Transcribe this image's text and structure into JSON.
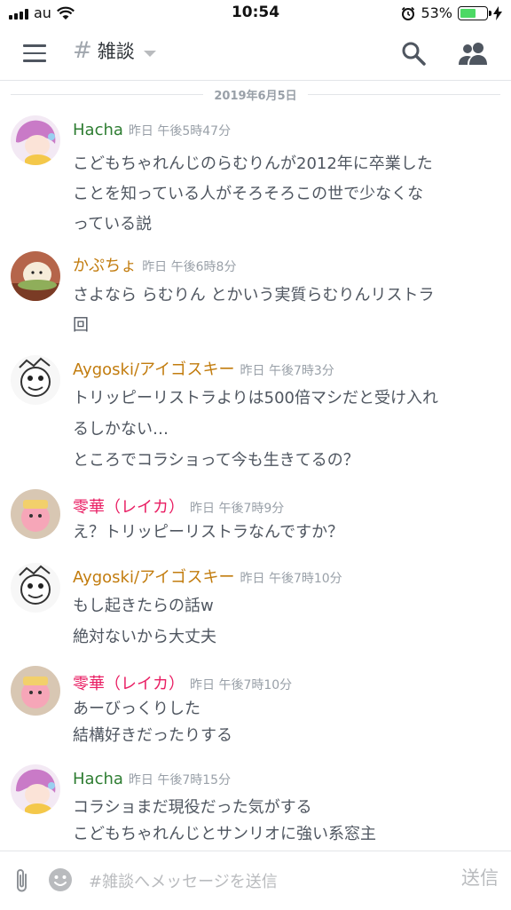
{
  "status": {
    "carrier": "au",
    "time": "10:54",
    "battery_pct": "53%",
    "battery_level": 0.53,
    "icons": [
      "signal-icon",
      "wifi-icon",
      "alarm-icon",
      "battery-icon",
      "charging-icon"
    ]
  },
  "header": {
    "hash": "#",
    "channel": "雑談",
    "icons": [
      "menu-icon",
      "search-icon",
      "members-icon",
      "chevron-down-icon"
    ]
  },
  "date_divider": "2019年6月5日",
  "messages": [
    {
      "user": "Hacha",
      "color": "#2e7d32",
      "time": "昨日 午後5時47分",
      "lines": [
        "こどもちゃれんじのらむりんが2012年に卒業した",
        "ことを知っている人がそろそろこの世で少なくな",
        "っている説"
      ]
    },
    {
      "user": "かぷちょ",
      "color": "#c27c0e",
      "time": "昨日 午後6時8分",
      "lines": [
        "さよなら らむりん とかいう実質らむりんリストラ",
        "回"
      ]
    },
    {
      "user": "Aygoski/アイゴスキー",
      "color": "#c27c0e",
      "time": "昨日 午後7時3分",
      "lines": [
        "トリッピーリストラよりは500倍マシだと受け入れ",
        "るしかない…",
        "ところでコラショって今も生きてるの？"
      ]
    },
    {
      "user": "零華（レイカ）",
      "color": "#e91e63",
      "time": "昨日 午後7時9分",
      "lines": [
        "え？トリッピーリストラなんですか？"
      ]
    },
    {
      "user": "Aygoski/アイゴスキー",
      "color": "#c27c0e",
      "time": "昨日 午後7時10分",
      "lines": [
        "もし起きたらの話w",
        "絶対ないから大丈夫"
      ]
    },
    {
      "user": "零華（レイカ）",
      "color": "#e91e63",
      "time": "昨日 午後7時10分",
      "lines": [
        "あーびっくりした",
        "結構好きだったりする"
      ]
    },
    {
      "user": "Hacha",
      "color": "#2e7d32",
      "time": "昨日 午後7時15分",
      "lines": [
        "コラショまだ現役だった気がする",
        "こどもちゃれんじとサンリオに強い系窓主"
      ]
    }
  ],
  "input": {
    "placeholder": "#雑談へメッセージを送信",
    "send_label": "送信",
    "icons": [
      "attach-icon",
      "emoji-icon"
    ]
  }
}
